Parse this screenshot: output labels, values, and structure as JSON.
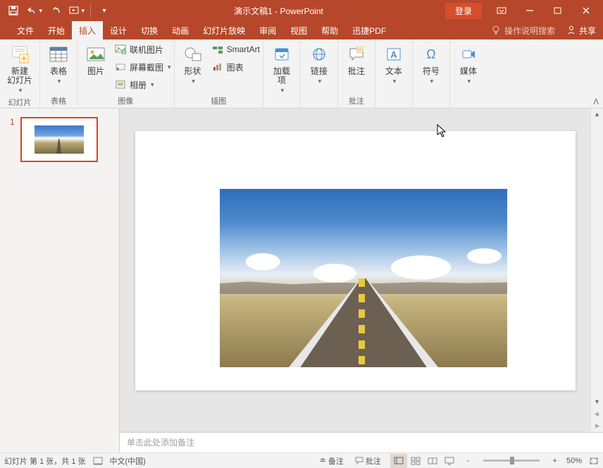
{
  "titlebar": {
    "title": "演示文稿1 - PowerPoint",
    "login": "登录"
  },
  "tabs": {
    "file": "文件",
    "home": "开始",
    "insert": "插入",
    "design": "设计",
    "transitions": "切换",
    "animations": "动画",
    "slideshow": "幻灯片放映",
    "review": "审阅",
    "view": "视图",
    "help": "帮助",
    "xunjie": "迅捷PDF",
    "tellme": "操作说明搜索",
    "share": "共享"
  },
  "ribbon": {
    "new_slide": "新建\n幻灯片",
    "slides_group": "幻灯片",
    "table": "表格",
    "table_group": "表格",
    "pictures": "图片",
    "online_pictures": "联机图片",
    "screenshot": "屏幕截图",
    "photo_album": "相册",
    "images_group": "图像",
    "shapes": "形状",
    "smartart": "SmartArt",
    "chart": "图表",
    "illustrations_group": "插图",
    "addins": "加载\n项",
    "links": "链接",
    "comment": "批注",
    "comments_group": "批注",
    "text": "文本",
    "symbols": "符号",
    "media": "媒体"
  },
  "thumbnails": {
    "slide1_num": "1"
  },
  "notes": {
    "placeholder": "单击此处添加备注"
  },
  "status": {
    "slide_info": "幻灯片 第 1 张，共 1 张",
    "language": "中文(中国)",
    "notes_btn": "备注",
    "comments_btn": "批注",
    "zoom_pct": "50%",
    "minus": "-",
    "plus": "+"
  }
}
